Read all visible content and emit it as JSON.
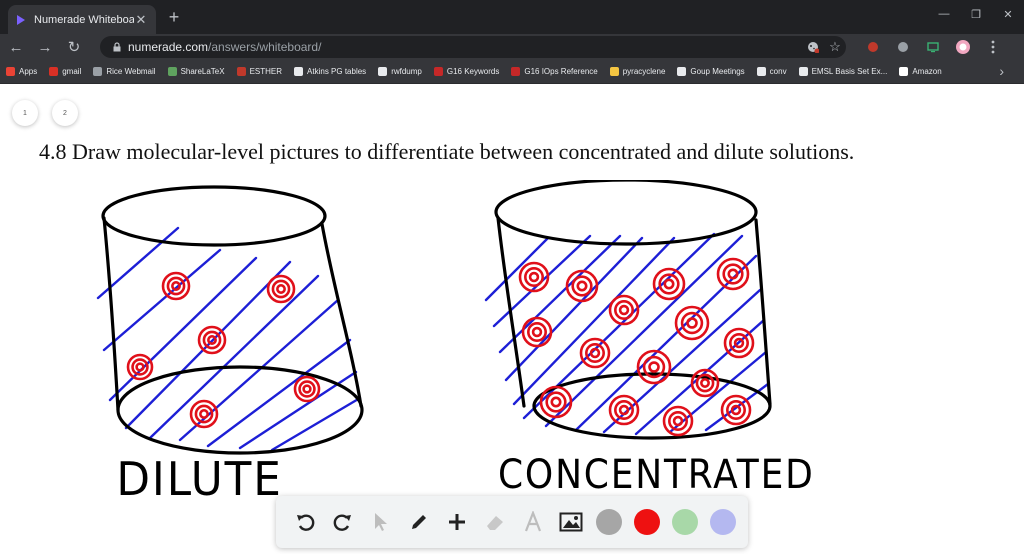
{
  "browser": {
    "tab_title": "Numerade Whiteboard",
    "new_tab": "+",
    "url_host": "numerade.com",
    "url_path": "/answers/whiteboard/",
    "window_controls": [
      "—",
      "❐",
      "✕"
    ]
  },
  "bookmarks": [
    {
      "label": "Apps",
      "color": "#ea4335"
    },
    {
      "label": "gmail",
      "color": "#d93025"
    },
    {
      "label": "Rice Webmail",
      "color": "#9aa0a6"
    },
    {
      "label": "ShareLaTeX",
      "color": "#5fa35f"
    },
    {
      "label": "ESTHER",
      "color": "#c0392b"
    },
    {
      "label": "Atkins PG tables",
      "color": "#e8eaed"
    },
    {
      "label": "rwfdump",
      "color": "#e8eaed"
    },
    {
      "label": "G16 Keywords",
      "color": "#c62828"
    },
    {
      "label": "G16 IOps Reference",
      "color": "#c62828"
    },
    {
      "label": "pyracyclene",
      "color": "#f4c542"
    },
    {
      "label": "Goup Meetings",
      "color": "#e8eaed"
    },
    {
      "label": "conv",
      "color": "#e8eaed"
    },
    {
      "label": "EMSL Basis Set Ex...",
      "color": "#e8eaed"
    },
    {
      "label": "Amazon",
      "color": "#ffffff"
    }
  ],
  "pages": [
    "1",
    "2"
  ],
  "question": "4.8 Draw molecular-level pictures to differentiate between concentrated and dilute solutions.",
  "labels": {
    "dilute": "DILUTE",
    "concentrated": "CONCENTRATED"
  },
  "colors": {
    "solvent_lines": "#1d1fd6",
    "particles": "#e0101a",
    "outline": "#000000"
  },
  "palette": [
    {
      "name": "gray",
      "color": "#a6a6a6"
    },
    {
      "name": "red",
      "color": "#ee1111"
    },
    {
      "name": "green",
      "color": "#a8d8a8"
    },
    {
      "name": "lavender",
      "color": "#b4b8f0"
    }
  ]
}
